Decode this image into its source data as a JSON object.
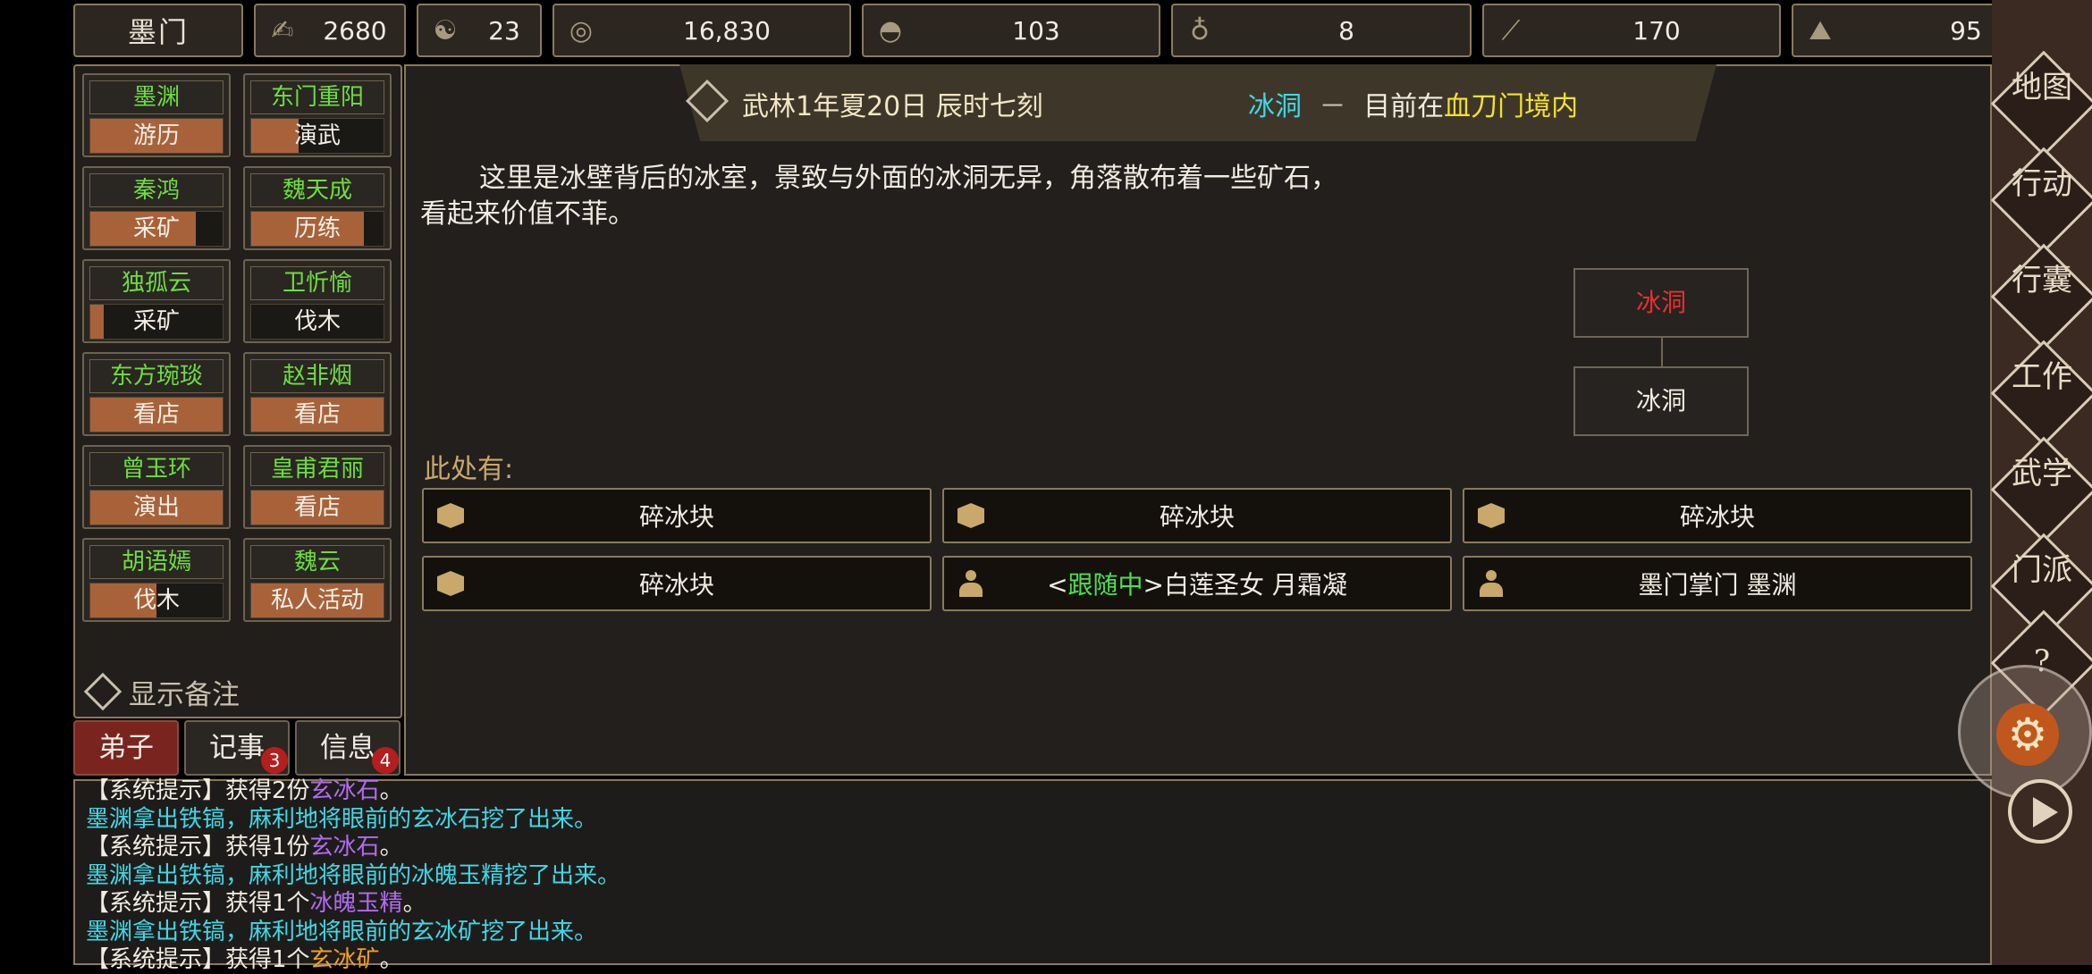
{
  "topbar": {
    "sect_name": "墨门",
    "resources": [
      {
        "icon": "reputation-icon",
        "value": "2680"
      },
      {
        "icon": "yin-yang-icon",
        "value": "23"
      },
      {
        "icon": "coin-icon",
        "value": "16,830"
      },
      {
        "icon": "food-bowl-icon",
        "value": "103"
      },
      {
        "icon": "gourd-icon",
        "value": "8"
      },
      {
        "icon": "wood-icon",
        "value": "170"
      },
      {
        "icon": "ore-icon",
        "value": "95"
      }
    ]
  },
  "disciples": [
    {
      "name": "墨渊",
      "activity": "游历",
      "progress": 1.0
    },
    {
      "name": "东门重阳",
      "activity": "演武",
      "progress": 0.36
    },
    {
      "name": "秦鸿",
      "activity": "采矿",
      "progress": 0.8
    },
    {
      "name": "魏天成",
      "activity": "历练",
      "progress": 0.85
    },
    {
      "name": "独孤云",
      "activity": "采矿",
      "progress": 0.1
    },
    {
      "name": "卫忻愉",
      "activity": "伐木",
      "progress": 0.0
    },
    {
      "name": "东方琬琰",
      "activity": "看店",
      "progress": 1.0
    },
    {
      "name": "赵非烟",
      "activity": "看店",
      "progress": 1.0
    },
    {
      "name": "曾玉环",
      "activity": "演出",
      "progress": 1.0
    },
    {
      "name": "皇甫君丽",
      "activity": "看店",
      "progress": 1.0
    },
    {
      "name": "胡语嫣",
      "activity": "伐木",
      "progress": 0.5
    },
    {
      "name": "魏云",
      "activity": "私人活动",
      "progress": 1.0
    }
  ],
  "show_notes_label": "显示备注",
  "tabs": [
    {
      "label": "弟子",
      "badge": ""
    },
    {
      "label": "记事",
      "badge": "3"
    },
    {
      "label": "信息",
      "badge": "4"
    }
  ],
  "header": {
    "date": "武林1年夏20日 辰时七刻",
    "location": "冰洞",
    "separator": "－",
    "status_prefix": "目前在",
    "territory": "血刀门境内"
  },
  "description": "这里是冰壁背后的冰室，景致与外面的冰洞无异，角落散布着一些矿石，看起来价值不菲。",
  "map": {
    "current": "冰洞",
    "connected": "冰洞"
  },
  "here_label": "此处有:",
  "items": [
    {
      "icon": "box",
      "text": "碎冰块"
    },
    {
      "icon": "box",
      "text": "碎冰块"
    },
    {
      "icon": "box",
      "text": "碎冰块"
    },
    {
      "icon": "box",
      "text": "碎冰块"
    },
    {
      "icon": "person",
      "tag_open": "<",
      "tag": "跟随中",
      "tag_close": ">",
      "text": "白莲圣女 月霜凝"
    },
    {
      "icon": "person",
      "text": "墨门掌门 墨渊"
    }
  ],
  "log": [
    {
      "parts": [
        {
          "t": "【系统提示】获得2份",
          "c": "#f1ece2"
        },
        {
          "t": "玄冰石",
          "c": "#b06cf0"
        },
        {
          "t": "。",
          "c": "#f1ece2"
        }
      ]
    },
    {
      "parts": [
        {
          "t": "墨渊拿出铁镐，麻利地将眼前的玄冰石挖了出来。",
          "c": "#3fd8e6"
        }
      ]
    },
    {
      "parts": [
        {
          "t": "【系统提示】获得1份",
          "c": "#f1ece2"
        },
        {
          "t": "玄冰石",
          "c": "#b06cf0"
        },
        {
          "t": "。",
          "c": "#f1ece2"
        }
      ]
    },
    {
      "parts": [
        {
          "t": "墨渊拿出铁镐，麻利地将眼前的冰魄玉精挖了出来。",
          "c": "#3fd8e6"
        }
      ]
    },
    {
      "parts": [
        {
          "t": "【系统提示】获得1个",
          "c": "#f1ece2"
        },
        {
          "t": "冰魄玉精",
          "c": "#b06cf0"
        },
        {
          "t": "。",
          "c": "#f1ece2"
        }
      ]
    },
    {
      "parts": [
        {
          "t": "墨渊拿出铁镐，麻利地将眼前的玄冰矿挖了出来。",
          "c": "#3fd8e6"
        }
      ]
    },
    {
      "parts": [
        {
          "t": "【系统提示】获得1个",
          "c": "#f1ece2"
        },
        {
          "t": "玄冰矿",
          "c": "#f0a020"
        },
        {
          "t": "。",
          "c": "#f1ece2"
        }
      ]
    }
  ],
  "side_menu": [
    {
      "label": "地图"
    },
    {
      "label": "行动"
    },
    {
      "label": "行囊"
    },
    {
      "label": "工作"
    },
    {
      "label": "武学"
    },
    {
      "label": "门派"
    },
    {
      "label": "?"
    }
  ],
  "colors": {
    "disciple_name": "#6ede3e",
    "location": "#3fd8e6",
    "territory": "#f4e030",
    "map_current": "#e83030",
    "follow_tag": "#4ee04e"
  }
}
